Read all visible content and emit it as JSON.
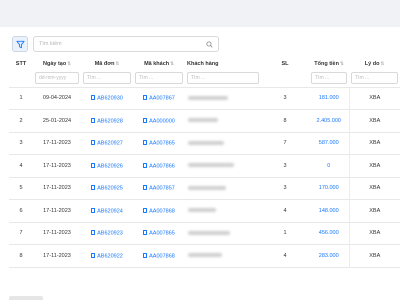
{
  "search": {
    "placeholder": "Tìm kiếm"
  },
  "table": {
    "headers": [
      "STT",
      "Ngày tạo",
      "Mã đơn",
      "Mã khách",
      "Khách hàng",
      "SL",
      "Tổng tiền",
      "Lý do"
    ],
    "filter_placeholders": {
      "date": "dd-mm-yyyy",
      "text": "Tìm ..."
    },
    "rows": [
      {
        "stt": "1",
        "date": "09-04-2024",
        "order": "AB620930",
        "customer_code": "AA007867",
        "qty": "3",
        "total": "181.000",
        "reason": "XBA"
      },
      {
        "stt": "2",
        "date": "25-01-2024",
        "order": "AB620928",
        "customer_code": "AA000000",
        "qty": "8",
        "total": "2.405.000",
        "reason": "XBA"
      },
      {
        "stt": "3",
        "date": "17-11-2023",
        "order": "AB620927",
        "customer_code": "AA007865",
        "qty": "7",
        "total": "587.000",
        "reason": "XBA"
      },
      {
        "stt": "4",
        "date": "17-11-2023",
        "order": "AB620926",
        "customer_code": "AA007866",
        "qty": "3",
        "total": "0",
        "reason": "XBA"
      },
      {
        "stt": "5",
        "date": "17-11-2023",
        "order": "AB620925",
        "customer_code": "AA007857",
        "qty": "3",
        "total": "170.000",
        "reason": "XBA"
      },
      {
        "stt": "6",
        "date": "17-11-2023",
        "order": "AB620924",
        "customer_code": "AA007868",
        "qty": "4",
        "total": "148.000",
        "reason": "XBA"
      },
      {
        "stt": "7",
        "date": "17-11-2023",
        "order": "AB620923",
        "customer_code": "AA007865",
        "qty": "1",
        "total": "456.000",
        "reason": "XBA"
      },
      {
        "stt": "8",
        "date": "17-11-2023",
        "order": "AB620922",
        "customer_code": "AA007868",
        "qty": "4",
        "total": "283.000",
        "reason": "XBA"
      }
    ]
  },
  "colors": {
    "link": "#1677ff",
    "filter_icon": "#1677ff"
  }
}
